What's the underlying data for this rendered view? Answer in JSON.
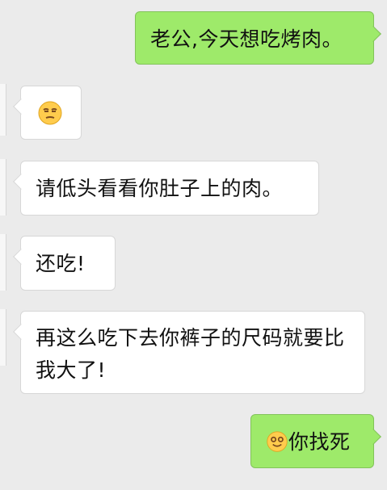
{
  "conversation": {
    "messages": [
      {
        "sender": "self",
        "text": "老公,今天想吃烤肉。"
      },
      {
        "sender": "other",
        "emoji": "unamused-face-icon"
      },
      {
        "sender": "other",
        "text": "请低头看看你肚子上的肉。"
      },
      {
        "sender": "other",
        "text": "还吃!"
      },
      {
        "sender": "other",
        "text": "再这么吃下去你裤子的尺码就要比我大了!"
      },
      {
        "sender": "self",
        "emoji": "smiling-face-icon",
        "text": "你找死"
      }
    ]
  },
  "colors": {
    "background": "#ebebeb",
    "incoming_bubble": "#ffffff",
    "outgoing_bubble": "#9eea6a"
  }
}
